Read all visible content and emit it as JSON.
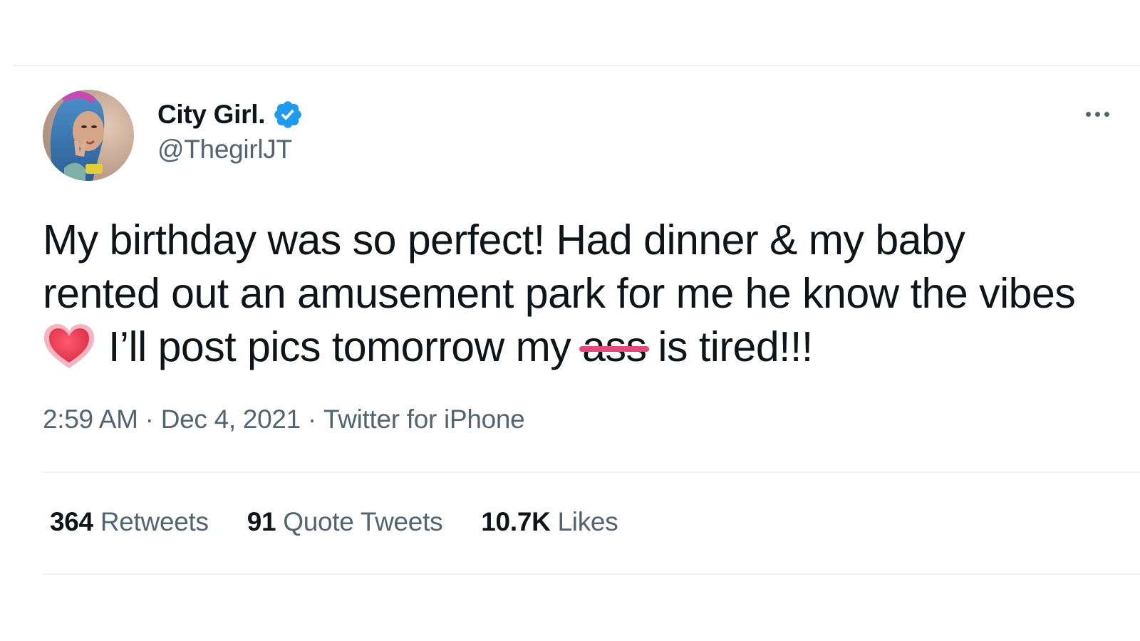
{
  "user": {
    "display_name": "City Girl.",
    "handle": "@ThegirlJT",
    "verified": true
  },
  "tweet": {
    "text_before_emoji": "My birthday was so perfect! Had dinner & my baby rented out an amusement park for me he know the vibes",
    "emoji": "heart-emoji",
    "text_after_emoji": "I’ll post pics tomorrow my ",
    "struck_word": "ass",
    "text_end": " is tired!!!"
  },
  "meta": {
    "time": "2:59 AM",
    "separator": "·",
    "date": "Dec 4, 2021",
    "source": "Twitter for iPhone"
  },
  "stats": {
    "retweets_count": "364",
    "retweets_label": "Retweets",
    "quotes_count": "91",
    "quotes_label": "Quote Tweets",
    "likes_count": "10.7K",
    "likes_label": "Likes"
  },
  "colors": {
    "text_primary": "#0f1419",
    "text_secondary": "#536471",
    "verified_blue": "#1d9bf0",
    "divider": "#eff3f4",
    "strike_pink": "#e8467c",
    "heart_red": "#e8374f"
  }
}
